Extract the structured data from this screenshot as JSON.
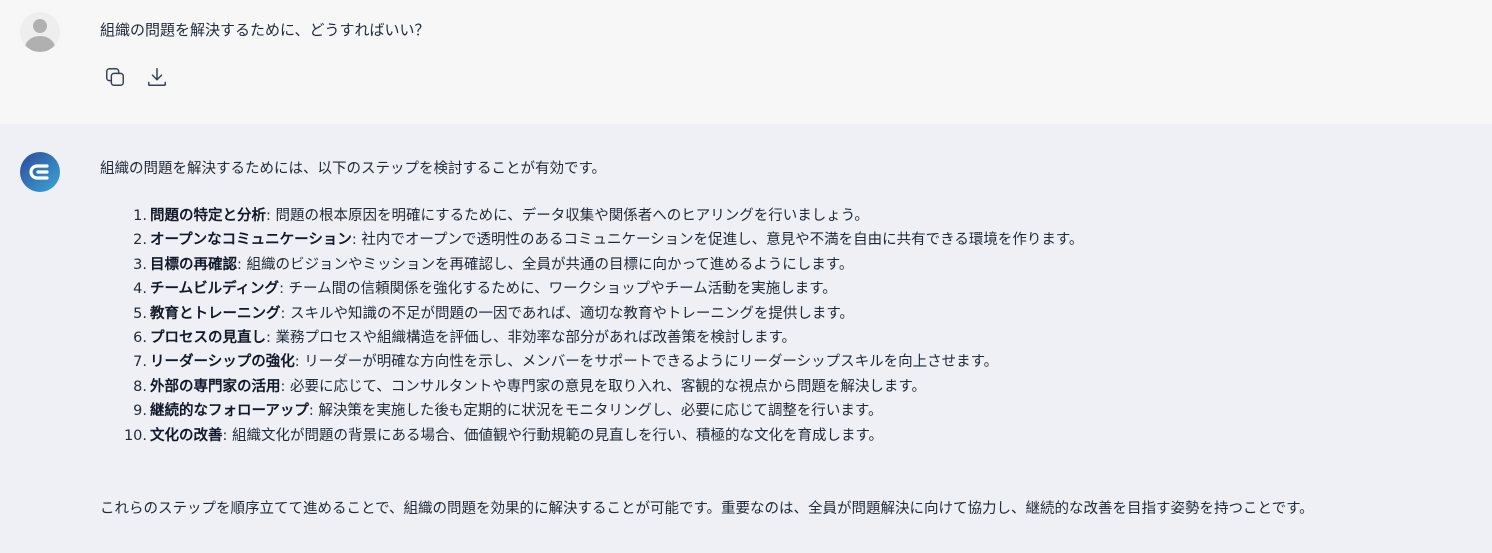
{
  "user_message": {
    "text": "組織の問題を解決するために、どうすればいい？",
    "icons": [
      "copy-icon",
      "download-icon"
    ]
  },
  "assistant_message": {
    "intro": "組織の問題を解決するためには、以下のステップを検討することが有効です。",
    "steps": [
      {
        "number": "1.",
        "title": "問題の特定と分析",
        "text": ": 問題の根本原因を明確にするために、データ収集や関係者へのヒアリングを行いましょう。"
      },
      {
        "number": "2.",
        "title": "オープンなコミュニケーション",
        "text": ": 社内でオープンで透明性のあるコミュニケーションを促進し、意見や不満を自由に共有できる環境を作ります。"
      },
      {
        "number": "3.",
        "title": "目標の再確認",
        "text": ": 組織のビジョンやミッションを再確認し、全員が共通の目標に向かって進めるようにします。"
      },
      {
        "number": "4.",
        "title": "チームビルディング",
        "text": ": チーム間の信頼関係を強化するために、ワークショップやチーム活動を実施します。"
      },
      {
        "number": "5.",
        "title": "教育とトレーニング",
        "text": ": スキルや知識の不足が問題の一因であれば、適切な教育やトレーニングを提供します。"
      },
      {
        "number": "6.",
        "title": "プロセスの見直し",
        "text": ": 業務プロセスや組織構造を評価し、非効率な部分があれば改善策を検討します。"
      },
      {
        "number": "7.",
        "title": "リーダーシップの強化",
        "text": ": リーダーが明確な方向性を示し、メンバーをサポートできるようにリーダーシップスキルを向上させます。"
      },
      {
        "number": "8.",
        "title": "外部の専門家の活用",
        "text": ": 必要に応じて、コンサルタントや専門家の意見を取り入れ、客観的な視点から問題を解決します。"
      },
      {
        "number": "9.",
        "title": "継続的なフォローアップ",
        "text": ": 解決策を実施した後も定期的に状況をモニタリングし、必要に応じて調整を行います。"
      },
      {
        "number": "10.",
        "title": "文化の改善",
        "text": ": 組織文化が問題の背景にある場合、価値観や行動規範の見直しを行い、積極的な文化を育成します。"
      }
    ],
    "conclusion": "これらのステップを順序立てて進めることで、組織の問題を効果的に解決することが可能です。重要なのは、全員が問題解決に向けて協力し、継続的な改善を目指す姿勢を持つことです。"
  },
  "colors": {
    "user_bg": "#f7f7f8",
    "assistant_bg": "#eef0f5",
    "text": "#1f2937",
    "avatar_gradient_start": "#2c4a9a",
    "avatar_gradient_end": "#3aa7d8"
  }
}
